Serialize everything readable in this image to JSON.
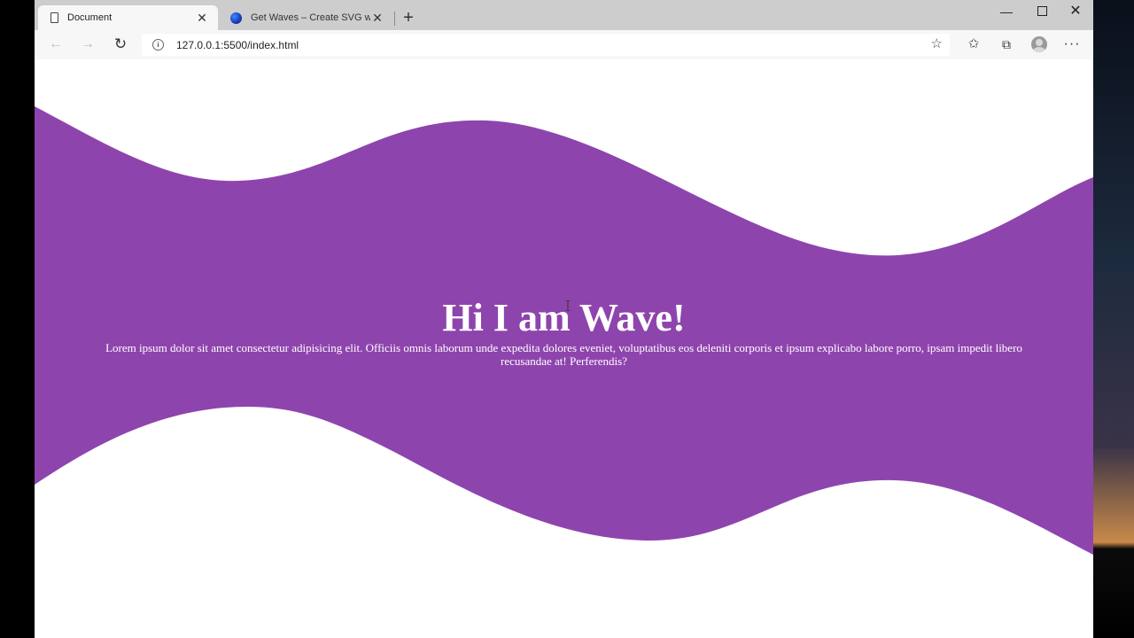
{
  "browser": {
    "tabs": [
      {
        "title": "Document",
        "icon": "document-icon",
        "active": true
      },
      {
        "title": "Get Waves – Create SVG waves f",
        "icon": "globe-icon",
        "active": false
      }
    ],
    "address": {
      "url": "127.0.0.1:5500/index.html"
    }
  },
  "page": {
    "wave_color": "#8e44ad",
    "heading": "Hi I am Wave!",
    "paragraph": "Lorem ipsum dolor sit amet consectetur adipisicing elit. Officiis omnis laborum unde expedita dolores eveniet, voluptatibus eos deleniti corporis et ipsum explicabo labore porro, ipsam impedit libero recusandae at! Perferendis?"
  }
}
